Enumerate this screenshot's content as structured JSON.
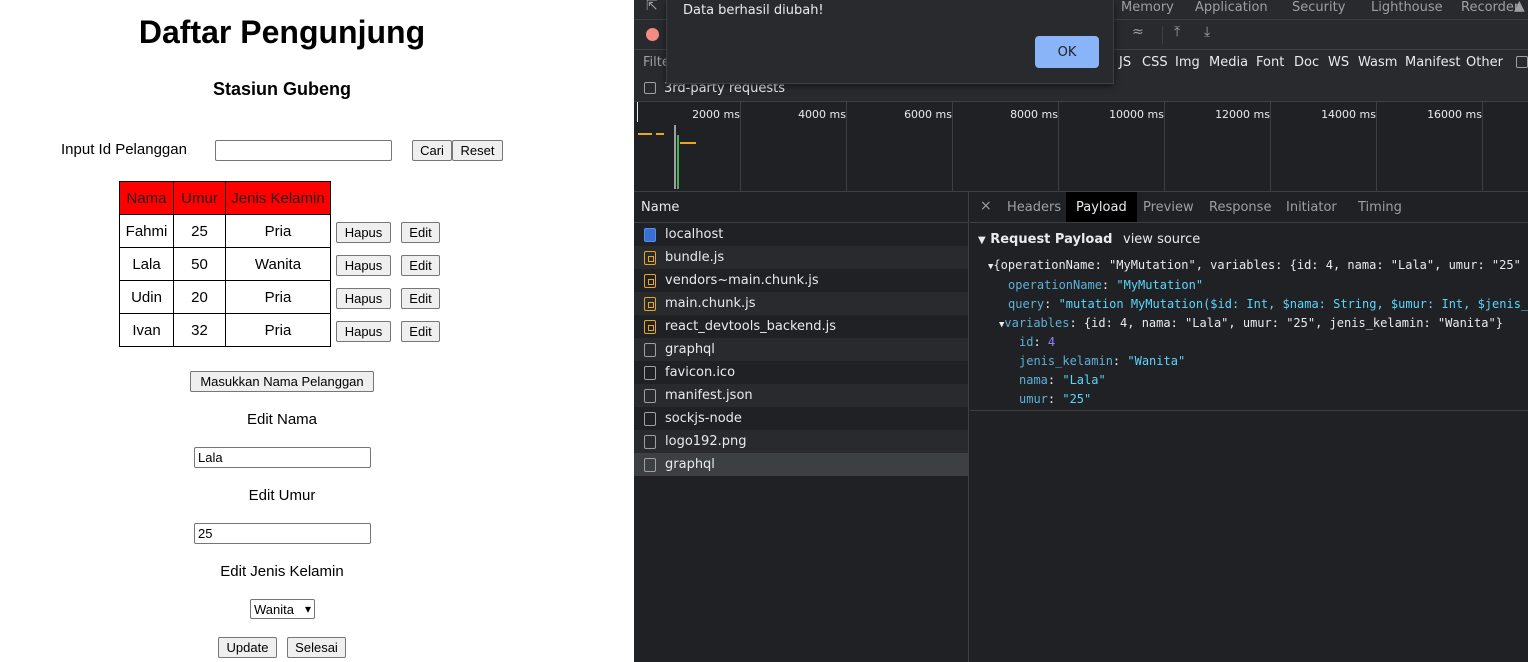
{
  "app": {
    "title": "Daftar Pengunjung",
    "subtitle": "Stasiun Gubeng",
    "search": {
      "label": "Input Id Pelanggan",
      "value": "",
      "search_button": "Cari",
      "reset_button": "Reset"
    },
    "table": {
      "headers": [
        "Nama",
        "Umur",
        "Jenis Kelamin"
      ],
      "rows": [
        {
          "nama": "Fahmi",
          "umur": "25",
          "jk": "Pria"
        },
        {
          "nama": "Lala",
          "umur": "50",
          "jk": "Wanita"
        },
        {
          "nama": "Udin",
          "umur": "20",
          "jk": "Pria"
        },
        {
          "nama": "Ivan",
          "umur": "32",
          "jk": "Pria"
        }
      ],
      "delete_label": "Hapus",
      "edit_label": "Edit"
    },
    "add_button": "Masukkan Nama Pelanggan",
    "edit_nama_label": "Edit Nama",
    "edit_nama_value": "Lala",
    "edit_umur_label": "Edit Umur",
    "edit_umur_value": "25",
    "edit_jk_label": "Edit Jenis Kelamin",
    "edit_jk_value": "Wanita",
    "update_button": "Update",
    "done_button": "Selesai"
  },
  "devtools": {
    "top_tabs": [
      "Memory",
      "Application",
      "Security",
      "Lighthouse",
      "Recorder"
    ],
    "filter_placeholder": "Filte",
    "filter_types": [
      "JS",
      "CSS",
      "Img",
      "Media",
      "Font",
      "Doc",
      "WS",
      "Wasm",
      "Manifest",
      "Other"
    ],
    "third_party_label": "3rd-party requests",
    "timeline_ticks": [
      "2000 ms",
      "4000 ms",
      "6000 ms",
      "8000 ms",
      "10000 ms",
      "12000 ms",
      "14000 ms",
      "16000 ms"
    ],
    "name_header": "Name",
    "requests": [
      {
        "name": "localhost",
        "kind": "doc"
      },
      {
        "name": "bundle.js",
        "kind": "js"
      },
      {
        "name": "vendors~main.chunk.js",
        "kind": "js"
      },
      {
        "name": "main.chunk.js",
        "kind": "js"
      },
      {
        "name": "react_devtools_backend.js",
        "kind": "js"
      },
      {
        "name": "graphql",
        "kind": "other"
      },
      {
        "name": "favicon.ico",
        "kind": "other"
      },
      {
        "name": "manifest.json",
        "kind": "other"
      },
      {
        "name": "sockjs-node",
        "kind": "other"
      },
      {
        "name": "logo192.png",
        "kind": "other"
      },
      {
        "name": "graphql",
        "kind": "other"
      }
    ],
    "detail_tabs": [
      "Headers",
      "Payload",
      "Preview",
      "Response",
      "Initiator",
      "Timing"
    ],
    "active_tab": "Payload",
    "payload": {
      "title": "Request Payload",
      "view_source": "view source",
      "summary": "{operationName: \"MyMutation\", variables: {id: 4, nama: \"Lala\", umur: \"25\"",
      "operationName_key": "operationName",
      "operationName_val": "\"MyMutation\"",
      "query_key": "query",
      "query_val": "\"mutation MyMutation($id: Int, $nama: String, $umur: Int, $jenis_",
      "variables_key": "variables",
      "variables_summary": "{id: 4, nama: \"Lala\", umur: \"25\", jenis_kelamin: \"Wanita\"}",
      "vars": [
        {
          "key": "id",
          "val": "4"
        },
        {
          "key": "jenis_kelamin",
          "val": "\"Wanita\""
        },
        {
          "key": "nama",
          "val": "\"Lala\""
        },
        {
          "key": "umur",
          "val": "\"25\""
        }
      ]
    },
    "dialog": {
      "message": "Data berhasil diubah!",
      "ok_label": "OK"
    }
  }
}
